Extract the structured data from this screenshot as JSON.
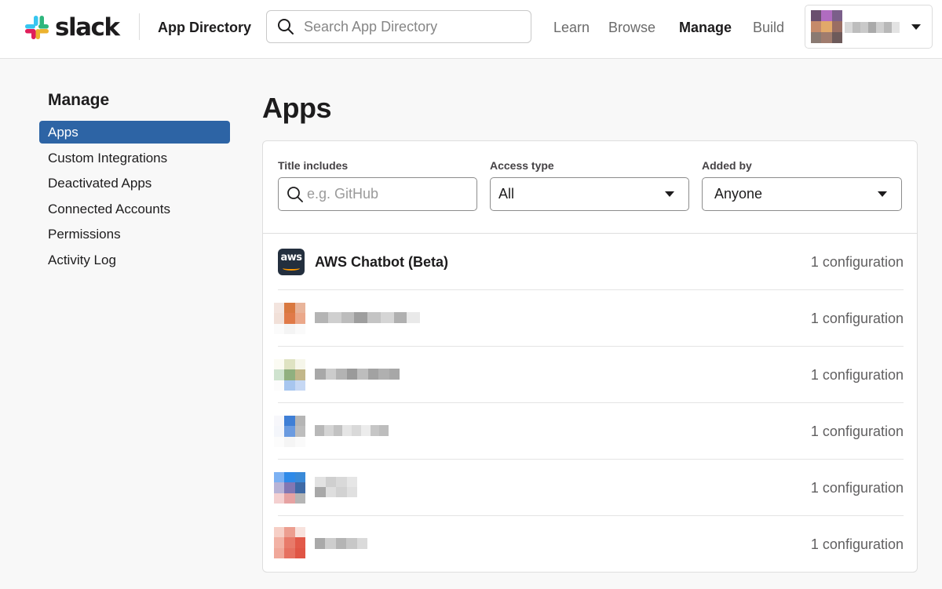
{
  "header": {
    "brand": "slack",
    "section_title": "App Directory",
    "search_placeholder": "Search App Directory",
    "nav": [
      {
        "label": "Learn",
        "active": false
      },
      {
        "label": "Browse",
        "active": false
      },
      {
        "label": "Manage",
        "active": true
      },
      {
        "label": "Build",
        "active": false
      }
    ]
  },
  "sidebar": {
    "title": "Manage",
    "items": [
      {
        "label": "Apps",
        "active": true
      },
      {
        "label": "Custom Integrations",
        "active": false
      },
      {
        "label": "Deactivated Apps",
        "active": false
      },
      {
        "label": "Connected Accounts",
        "active": false
      },
      {
        "label": "Permissions",
        "active": false
      },
      {
        "label": "Activity Log",
        "active": false
      }
    ]
  },
  "main": {
    "title": "Apps",
    "filters": {
      "title_label": "Title includes",
      "title_placeholder": "e.g. GitHub",
      "access_label": "Access type",
      "access_value": "All",
      "added_label": "Added by",
      "added_value": "Anyone"
    },
    "apps": [
      {
        "name": "AWS Chatbot (Beta)",
        "config": "1 configuration",
        "icon": "aws-logo-icon"
      },
      {
        "name": "",
        "config": "1 configuration",
        "icon": "app-icon"
      },
      {
        "name": "",
        "config": "1 configuration",
        "icon": "app-icon"
      },
      {
        "name": "",
        "config": "1 configuration",
        "icon": "app-icon"
      },
      {
        "name": "",
        "config": "1 configuration",
        "icon": "app-icon"
      },
      {
        "name": "",
        "config": "1 configuration",
        "icon": "app-icon"
      }
    ]
  },
  "colors": {
    "accent": "#2d64a5",
    "aws_dark": "#232f3e",
    "aws_orange": "#ff9900"
  }
}
